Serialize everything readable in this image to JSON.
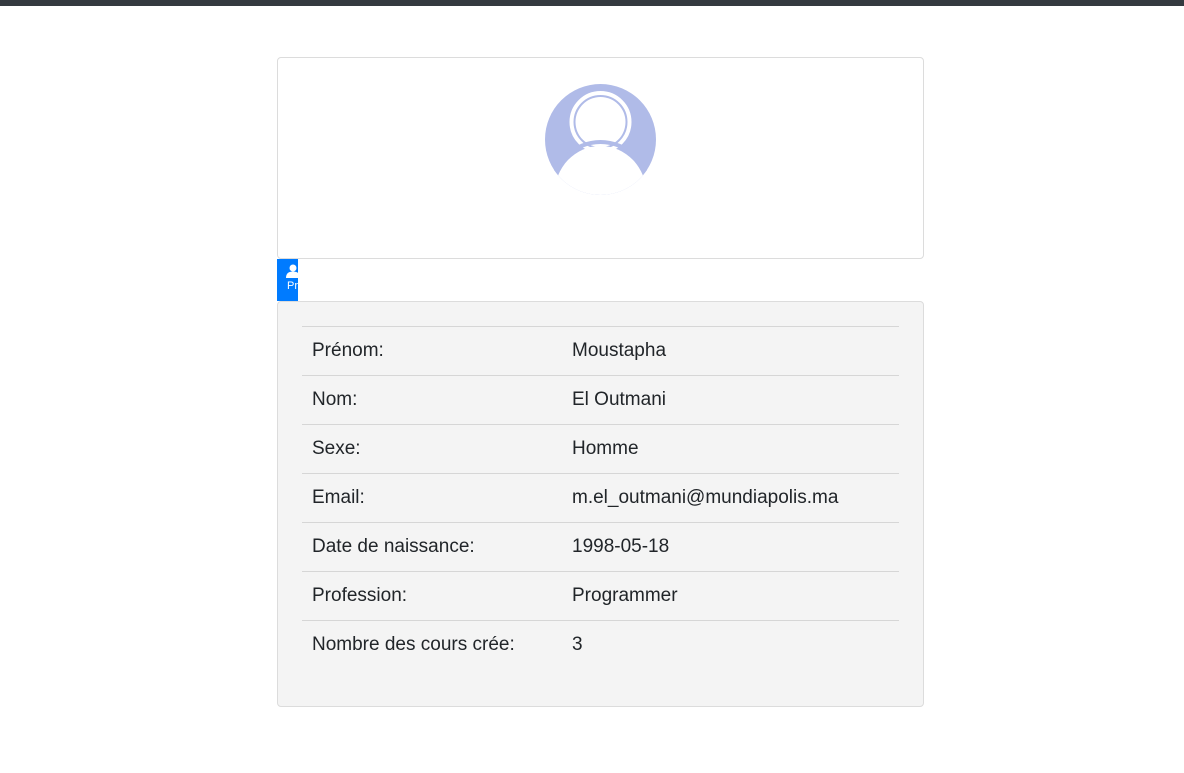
{
  "tab": {
    "label": "Profil",
    "icon": "user-icon",
    "color": "#007bff"
  },
  "avatar": {
    "icon": "user-avatar-icon",
    "color": "#b0bbe8"
  },
  "profile": {
    "rows": [
      {
        "label": "Prénom:",
        "value": "Moustapha"
      },
      {
        "label": "Nom:",
        "value": "El Outmani"
      },
      {
        "label": "Sexe:",
        "value": "Homme"
      },
      {
        "label": "Email:",
        "value": "m.el_outmani@mundiapolis.ma"
      },
      {
        "label": "Date de naissance:",
        "value": "1998-05-18"
      },
      {
        "label": "Profession:",
        "value": "Programmer"
      },
      {
        "label": "Nombre des cours crée:",
        "value": "3"
      }
    ]
  }
}
